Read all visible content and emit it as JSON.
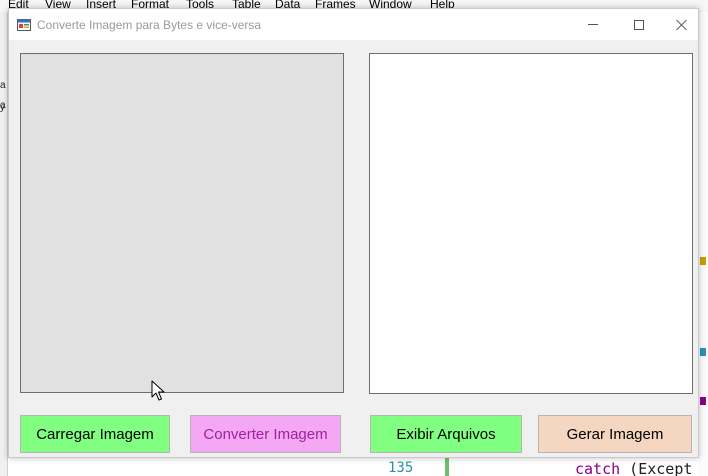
{
  "background_app": {
    "menu": [
      "Edit",
      "View",
      "Insert",
      "Format",
      "Tools",
      "Table",
      "Data",
      "Frames",
      "Window",
      "Help"
    ],
    "left_marks": [
      "a",
      "a",
      "y"
    ],
    "line_number": "135",
    "code_keyword": "catch",
    "code_rest": " (Except"
  },
  "window": {
    "title": "Converte Imagem para Bytes e vice-versa",
    "icon": "app-form-icon",
    "controls": {
      "minimize": "minimize-icon",
      "maximize": "maximize-icon",
      "close": "close-icon"
    }
  },
  "picture_boxes": {
    "left": {
      "background": "#e1e1e1"
    },
    "right": {
      "background": "#ffffff"
    }
  },
  "buttons": [
    {
      "label": "Carregar Imagem",
      "background": "#80ff80",
      "color": "#000000"
    },
    {
      "label": "Converter Imagem",
      "background": "#f4a8f4",
      "color": "#a020a0"
    },
    {
      "label": "Exibir Arquivos",
      "background": "#80ff80",
      "color": "#000000"
    },
    {
      "label": "Gerar Imagem",
      "background": "#f5d6c0",
      "color": "#000000"
    }
  ],
  "cursor": "mouse-pointer-icon"
}
